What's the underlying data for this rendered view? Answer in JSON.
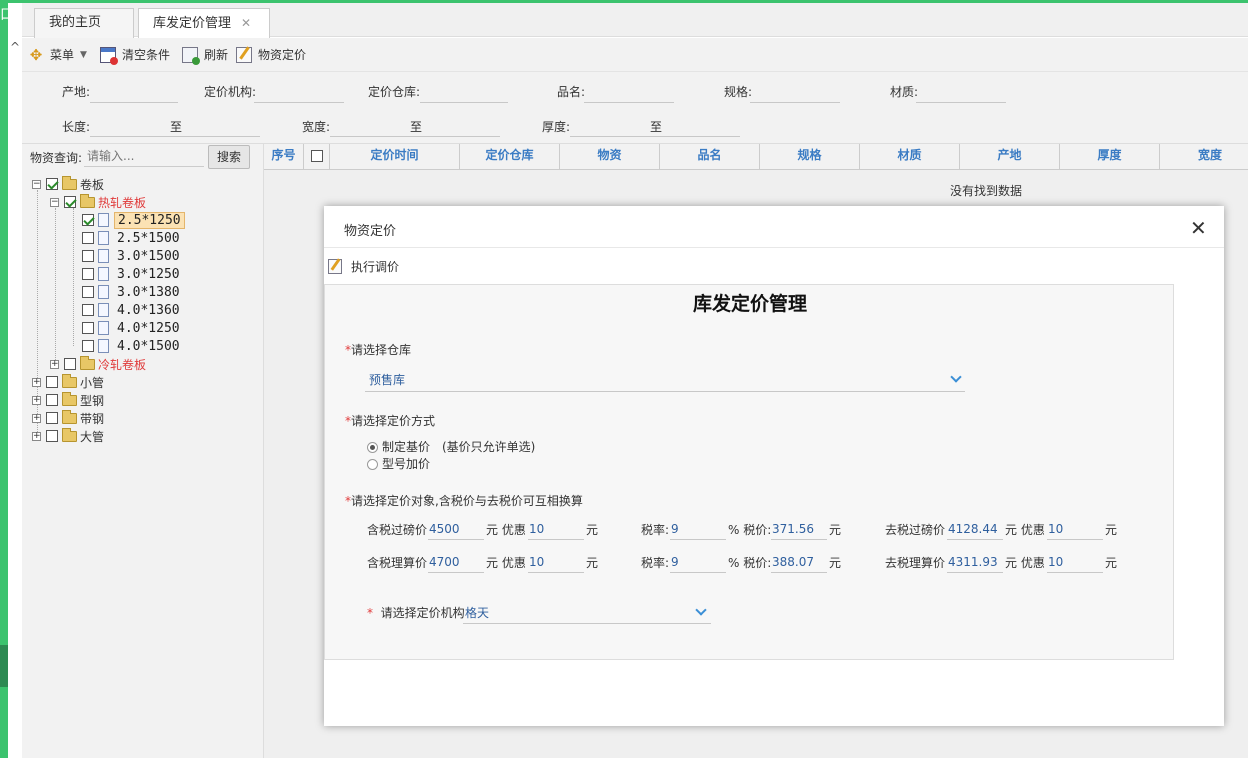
{
  "tabs": [
    {
      "label": "我的主页"
    },
    {
      "label": "库发定价管理",
      "close": "✕"
    }
  ],
  "toolbar": {
    "menu": "菜单",
    "clear": "清空条件",
    "refresh": "刷新",
    "pricing": "物资定价"
  },
  "filters": {
    "origin": "产地:",
    "org": "定价机构:",
    "warehouse": "定价仓库:",
    "name": "品名:",
    "spec": "规格:",
    "material": "材质:",
    "length": "长度:",
    "width": "宽度:",
    "thickness": "厚度:",
    "to": "至"
  },
  "search": {
    "label": "物资查询:",
    "placeholder": "请输入...",
    "button": "搜索"
  },
  "tree": {
    "root": "卷板",
    "hot": "热轧卷板",
    "leaves": [
      "2.5*1250",
      "2.5*1500",
      "3.0*1500",
      "3.0*1250",
      "3.0*1380",
      "4.0*1360",
      "4.0*1250",
      "4.0*1500"
    ],
    "cold": "冷轧卷板",
    "others": [
      "小管",
      "型钢",
      "带钢",
      "大管"
    ]
  },
  "grid": {
    "columns": [
      "序号",
      "",
      "定价时间",
      "定价仓库",
      "物资",
      "品名",
      "规格",
      "材质",
      "产地",
      "厚度",
      "宽度"
    ],
    "empty": "没有找到数据"
  },
  "modal": {
    "title": "物资定价",
    "close": "✕",
    "action": "执行调价",
    "heading": "库发定价管理",
    "warehouse_label": "请选择仓库",
    "warehouse_value": "预售库",
    "method_label": "请选择定价方式",
    "method_base": "制定基价",
    "method_note": "(基价只允许单选)",
    "method_model": "型号加价",
    "target_label": "请选择定价对象,含税价与去税价可互相换算",
    "rows": [
      {
        "incl_label": "含税过磅价",
        "incl": "4500",
        "yuan": "元",
        "disc_label": "优惠",
        "disc": "10",
        "tax_label": "税率:",
        "tax": "9",
        "tax_price_label": "% 税价:",
        "tax_price": "371.56",
        "excl_label": "去税过磅价",
        "excl": "4128.44",
        "disc2": "10"
      },
      {
        "incl_label": "含税理算价",
        "incl": "4700",
        "yuan": "元",
        "disc_label": "优惠",
        "disc": "10",
        "tax_label": "税率:",
        "tax": "9",
        "tax_price_label": "% 税价:",
        "tax_price": "388.07",
        "excl_label": "去税理算价",
        "excl": "4311.93",
        "disc2": "10"
      }
    ],
    "org_label": "请选择定价机构",
    "org_value": "格天"
  },
  "colors": {
    "green": "#3cc36e",
    "link": "#3b7cc4",
    "red": "#e03a3a"
  }
}
